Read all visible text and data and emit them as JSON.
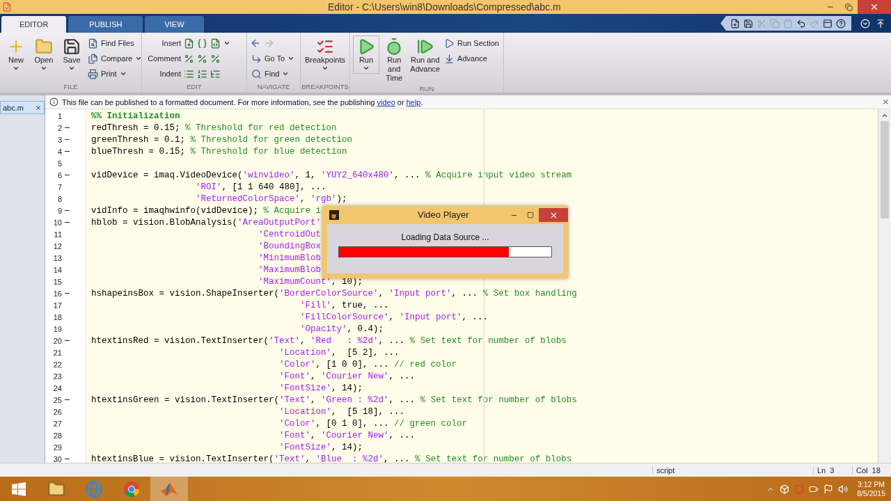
{
  "window": {
    "title": "Editor - C:\\Users\\win8\\Downloads\\Compressed\\abc.m"
  },
  "ribbon": {
    "tabs": [
      {
        "label": "EDITOR",
        "selected": true
      },
      {
        "label": "PUBLISH",
        "selected": false
      },
      {
        "label": "VIEW",
        "selected": false
      }
    ],
    "quick_access": [
      {
        "disabled": false
      },
      {
        "disabled": false
      },
      {
        "disabled": true
      },
      {
        "disabled": true
      },
      {
        "disabled": true
      },
      {
        "disabled": false
      },
      {
        "disabled": true
      },
      {
        "disabled": false
      },
      {
        "disabled": false
      }
    ],
    "groups": [
      {
        "label": "FILE",
        "items": [
          {
            "kind": "large",
            "label": "New",
            "dropdown": true
          },
          {
            "kind": "large",
            "label": "Open",
            "dropdown": true
          },
          {
            "kind": "large",
            "label": "Save",
            "dropdown": true
          },
          {
            "kind": "small",
            "label": "Find Files",
            "dropdown": false
          },
          {
            "kind": "small",
            "label": "Compare",
            "dropdown": true
          },
          {
            "kind": "small",
            "label": "Print",
            "dropdown": true
          }
        ]
      },
      {
        "label": "EDIT",
        "items": [
          {
            "kind": "row",
            "label": "Insert",
            "dropdown": true
          },
          {
            "kind": "row",
            "label": "Comment",
            "dropdown": false
          },
          {
            "kind": "row",
            "label": "Indent",
            "dropdown": false
          }
        ]
      },
      {
        "label": "NAVIGATE",
        "items": [
          {
            "kind": "history",
            "back_disabled": false,
            "forward_disabled": true
          },
          {
            "kind": "small",
            "label": "Go To",
            "dropdown": true
          },
          {
            "kind": "small",
            "label": "Find",
            "dropdown": true
          }
        ]
      },
      {
        "label": "BREAKPOINTS",
        "items": [
          {
            "kind": "large",
            "label": "Breakpoints",
            "dropdown": true
          }
        ]
      },
      {
        "label": "RUN",
        "items": [
          {
            "kind": "large",
            "label": "Run",
            "dropdown": true
          },
          {
            "kind": "large",
            "label": "Run and Time",
            "dropdown": false
          },
          {
            "kind": "large",
            "label": "Run and Advance",
            "dropdown": false
          },
          {
            "kind": "small",
            "label": "Run Section",
            "dropdown": false
          },
          {
            "kind": "small",
            "label": "Advance",
            "dropdown": false
          }
        ]
      }
    ]
  },
  "open_files": [
    {
      "name": "abc.m",
      "selected": true
    }
  ],
  "info_bar": {
    "parts": [
      {
        "text": "This file can be published to a formatted document. For more information, see the publishing ",
        "link": false
      },
      {
        "text": "video",
        "link": true
      },
      {
        "text": " or ",
        "link": false
      },
      {
        "text": "help",
        "link": true
      },
      {
        "text": ".",
        "link": false
      }
    ]
  },
  "code_lines": [
    {
      "number": "1",
      "executable": false,
      "tokens": [
        {
          "kind": "cell",
          "text": "%% Initialization"
        }
      ]
    },
    {
      "number": "2",
      "executable": true,
      "tokens": [
        {
          "kind": "code",
          "text": "redThresh = 0.15; "
        },
        {
          "kind": "comment",
          "text": "% Threshold for red detection"
        }
      ]
    },
    {
      "number": "3",
      "executable": true,
      "tokens": [
        {
          "kind": "code",
          "text": "greenThresh = 0.1; "
        },
        {
          "kind": "comment",
          "text": "% Threshold for green detection"
        }
      ]
    },
    {
      "number": "4",
      "executable": true,
      "tokens": [
        {
          "kind": "code",
          "text": "blueThresh = 0.15; "
        },
        {
          "kind": "comment",
          "text": "% Threshold for blue detection"
        }
      ]
    },
    {
      "number": "5",
      "executable": false
    },
    {
      "number": "6",
      "executable": true,
      "tokens": [
        {
          "kind": "code",
          "text": "vidDevice = imaq.VideoDevice("
        },
        {
          "kind": "string",
          "text": "'winvideo'"
        },
        {
          "kind": "code",
          "text": ", 1, "
        },
        {
          "kind": "string",
          "text": "'YUY2_640x480'"
        },
        {
          "kind": "code",
          "text": ", ... "
        },
        {
          "kind": "comment",
          "text": "% Acquire input video stream"
        }
      ]
    },
    {
      "number": "7",
      "executable": false,
      "tokens": [
        {
          "kind": "string",
          "text": "                    'ROI'"
        },
        {
          "kind": "code",
          "text": ", [1 1 640 480], ..."
        }
      ]
    },
    {
      "number": "8",
      "executable": false,
      "tokens": [
        {
          "kind": "string",
          "text": "                    'ReturnedColorSpace'"
        },
        {
          "kind": "code",
          "text": ", "
        },
        {
          "kind": "string",
          "text": "'rgb'"
        },
        {
          "kind": "code",
          "text": ");"
        }
      ]
    },
    {
      "number": "9",
      "executable": true,
      "tokens": [
        {
          "kind": "code",
          "text": "vidInfo = imaqhwinfo(vidDevice); "
        },
        {
          "kind": "comment",
          "text": "% Acquire i"
        }
      ]
    },
    {
      "number": "10",
      "executable": true,
      "tokens": [
        {
          "kind": "code",
          "text": "hblob = vision.BlobAnalysis("
        },
        {
          "kind": "string",
          "text": "'AreaOutputPort'"
        }
      ]
    },
    {
      "number": "11",
      "executable": false,
      "tokens": [
        {
          "kind": "string",
          "text": "                                'CentroidOut"
        }
      ]
    },
    {
      "number": "12",
      "executable": false,
      "tokens": [
        {
          "kind": "string",
          "text": "                                'BoundingBox"
        }
      ]
    },
    {
      "number": "13",
      "executable": false,
      "tokens": [
        {
          "kind": "string",
          "text": "                                'MinimumBlob"
        }
      ]
    },
    {
      "number": "14",
      "executable": false,
      "tokens": [
        {
          "kind": "string",
          "text": "                                'MaximumBlob"
        }
      ]
    },
    {
      "number": "15",
      "executable": false,
      "tokens": [
        {
          "kind": "string",
          "text": "                                'MaximumCount'"
        },
        {
          "kind": "code",
          "text": ", 10);"
        }
      ]
    },
    {
      "number": "16",
      "executable": true,
      "tokens": [
        {
          "kind": "code",
          "text": "hshapeinsBox = vision.ShapeInserter("
        },
        {
          "kind": "string",
          "text": "'BorderColorSource'"
        },
        {
          "kind": "code",
          "text": ", "
        },
        {
          "kind": "string",
          "text": "'Input port'"
        },
        {
          "kind": "code",
          "text": ", ... "
        },
        {
          "kind": "comment",
          "text": "% Set box handling"
        }
      ]
    },
    {
      "number": "17",
      "executable": false,
      "tokens": [
        {
          "kind": "string",
          "text": "                                        'Fill'"
        },
        {
          "kind": "code",
          "text": ", true, ..."
        }
      ]
    },
    {
      "number": "18",
      "executable": false,
      "tokens": [
        {
          "kind": "string",
          "text": "                                        'FillColorSource'"
        },
        {
          "kind": "code",
          "text": ", "
        },
        {
          "kind": "string",
          "text": "'Input port'"
        },
        {
          "kind": "code",
          "text": ", ..."
        }
      ]
    },
    {
      "number": "19",
      "executable": false,
      "tokens": [
        {
          "kind": "string",
          "text": "                                        'Opacity'"
        },
        {
          "kind": "code",
          "text": ", 0.4);"
        }
      ]
    },
    {
      "number": "20",
      "executable": true,
      "tokens": [
        {
          "kind": "code",
          "text": "htextinsRed = vision.TextInserter("
        },
        {
          "kind": "string",
          "text": "'Text'"
        },
        {
          "kind": "code",
          "text": ", "
        },
        {
          "kind": "string",
          "text": "'Red   : %2d'"
        },
        {
          "kind": "code",
          "text": ", ... "
        },
        {
          "kind": "comment",
          "text": "% Set text for number of blobs"
        }
      ]
    },
    {
      "number": "21",
      "executable": false,
      "tokens": [
        {
          "kind": "string",
          "text": "                                    'Location'"
        },
        {
          "kind": "code",
          "text": ",  [5 2], ..."
        }
      ]
    },
    {
      "number": "22",
      "executable": false,
      "tokens": [
        {
          "kind": "string",
          "text": "                                    'Color'"
        },
        {
          "kind": "code",
          "text": ", [1 0 0], ... "
        },
        {
          "kind": "comment",
          "text": "// red color"
        }
      ]
    },
    {
      "number": "23",
      "executable": false,
      "tokens": [
        {
          "kind": "string",
          "text": "                                    'Font'"
        },
        {
          "kind": "code",
          "text": ", "
        },
        {
          "kind": "string",
          "text": "'Courier New'"
        },
        {
          "kind": "code",
          "text": ", ..."
        }
      ]
    },
    {
      "number": "24",
      "executable": false,
      "tokens": [
        {
          "kind": "string",
          "text": "                                    'FontSize'"
        },
        {
          "kind": "code",
          "text": ", 14);"
        }
      ]
    },
    {
      "number": "25",
      "executable": true,
      "tokens": [
        {
          "kind": "code",
          "text": "htextinsGreen = vision.TextInserter("
        },
        {
          "kind": "string",
          "text": "'Text'"
        },
        {
          "kind": "code",
          "text": ", "
        },
        {
          "kind": "string",
          "text": "'Green : %2d'"
        },
        {
          "kind": "code",
          "text": ", ... "
        },
        {
          "kind": "comment",
          "text": "% Set text for number of blobs"
        }
      ]
    },
    {
      "number": "26",
      "executable": false,
      "tokens": [
        {
          "kind": "string",
          "text": "                                    'Location'"
        },
        {
          "kind": "code",
          "text": ",  [5 18], ..."
        }
      ]
    },
    {
      "number": "27",
      "executable": false,
      "tokens": [
        {
          "kind": "string",
          "text": "                                    'Color'"
        },
        {
          "kind": "code",
          "text": ", [0 1 0], ... "
        },
        {
          "kind": "comment",
          "text": "// green color"
        }
      ]
    },
    {
      "number": "28",
      "executable": false,
      "tokens": [
        {
          "kind": "string",
          "text": "                                    'Font'"
        },
        {
          "kind": "code",
          "text": ", "
        },
        {
          "kind": "string",
          "text": "'Courier New'"
        },
        {
          "kind": "code",
          "text": ", ..."
        }
      ]
    },
    {
      "number": "29",
      "executable": false,
      "tokens": [
        {
          "kind": "string",
          "text": "                                    'FontSize'"
        },
        {
          "kind": "code",
          "text": ", 14);"
        }
      ]
    },
    {
      "number": "30",
      "executable": true,
      "tokens": [
        {
          "kind": "code",
          "text": "htextinsBlue = vision.TextInserter("
        },
        {
          "kind": "string",
          "text": "'Text'"
        },
        {
          "kind": "code",
          "text": ", "
        },
        {
          "kind": "string",
          "text": "'Blue  : %2d'"
        },
        {
          "kind": "code",
          "text": ", ... "
        },
        {
          "kind": "comment",
          "text": "% Set text for number of blobs"
        }
      ]
    }
  ],
  "dialog": {
    "title": "Video Player",
    "message": "Loading Data Source ...",
    "level": 0.8
  },
  "status_bar": {
    "type": "script",
    "line_label": "Ln",
    "line": "3",
    "col_label": "Col",
    "col": "18"
  },
  "taskbar": {
    "apps": [
      {
        "selected": false
      },
      {
        "selected": false
      },
      {
        "selected": false
      },
      {
        "selected": true
      }
    ],
    "time": "3:12 PM",
    "date": "8/5/2015"
  }
}
